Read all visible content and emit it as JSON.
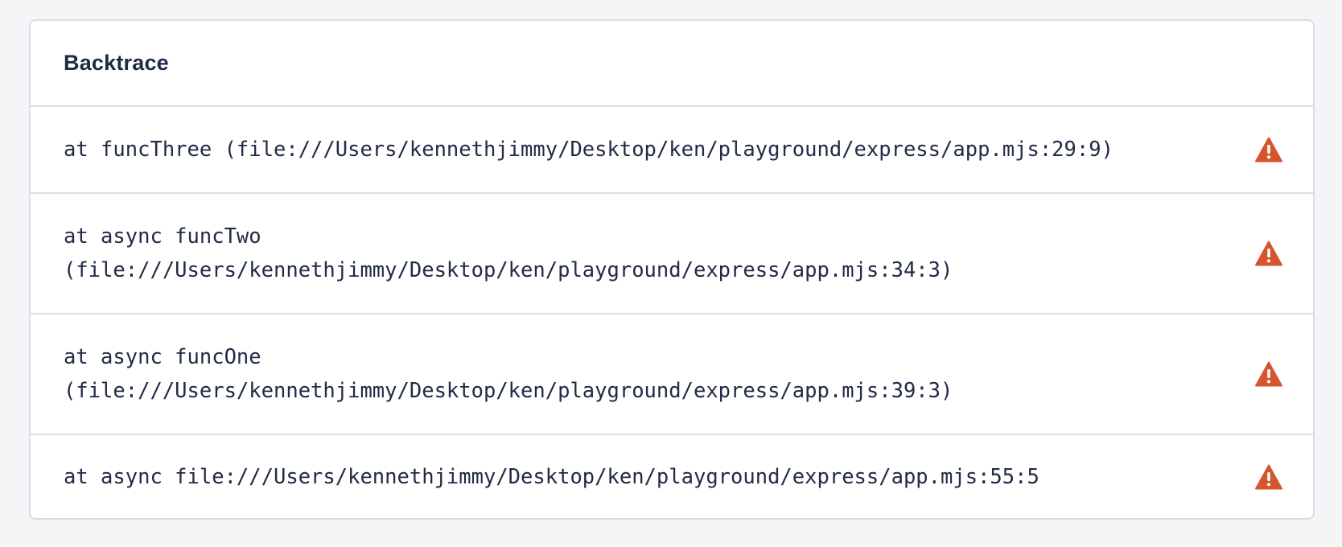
{
  "panel": {
    "title": "Backtrace"
  },
  "frames": [
    {
      "text": "at funcThree (file:///Users/kennethjimmy/Desktop/ken/playground/express/app.mjs:29:9)",
      "icon": "warning-icon"
    },
    {
      "text": "at async funcTwo\n(file:///Users/kennethjimmy/Desktop/ken/playground/express/app.mjs:34:3)",
      "icon": "warning-icon"
    },
    {
      "text": "at async funcOne\n(file:///Users/kennethjimmy/Desktop/ken/playground/express/app.mjs:39:3)",
      "icon": "warning-icon"
    },
    {
      "text": "at async file:///Users/kennethjimmy/Desktop/ken/playground/express/app.mjs:55:5",
      "icon": "warning-icon"
    }
  ],
  "colors": {
    "warning": "#d6552d",
    "text": "#222b45",
    "border": "#d9dde5",
    "background": "#f4f5f7"
  }
}
